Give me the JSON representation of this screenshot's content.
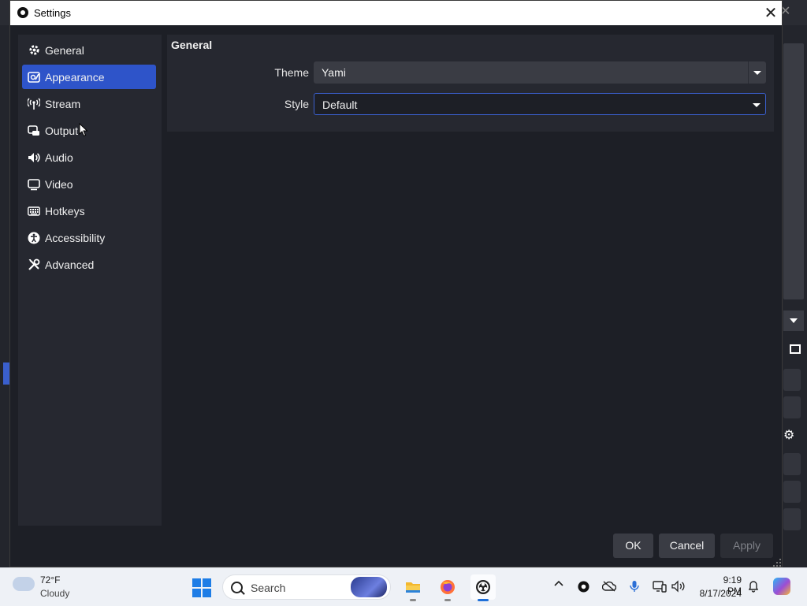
{
  "window": {
    "title": "Settings",
    "close_glyph": "✕"
  },
  "sidebar": {
    "items": [
      {
        "label": "General",
        "icon": "gear-icon",
        "active": false
      },
      {
        "label": "Appearance",
        "icon": "appearance-icon",
        "active": true
      },
      {
        "label": "Stream",
        "icon": "broadcast-icon",
        "active": false
      },
      {
        "label": "Output",
        "icon": "output-icon",
        "active": false
      },
      {
        "label": "Audio",
        "icon": "speaker-icon",
        "active": false
      },
      {
        "label": "Video",
        "icon": "monitor-icon",
        "active": false
      },
      {
        "label": "Hotkeys",
        "icon": "keyboard-icon",
        "active": false
      },
      {
        "label": "Accessibility",
        "icon": "accessibility-icon",
        "active": false
      },
      {
        "label": "Advanced",
        "icon": "tools-icon",
        "active": false
      }
    ]
  },
  "main": {
    "section_title": "General",
    "theme": {
      "label": "Theme",
      "value": "Yami"
    },
    "style": {
      "label": "Style",
      "value": "Default"
    }
  },
  "buttons": {
    "ok": "OK",
    "cancel": "Cancel",
    "apply": "Apply"
  },
  "taskbar": {
    "weather": {
      "temp": "72°F",
      "condition": "Cloudy"
    },
    "search_placeholder": "Search",
    "apps": [
      "file-explorer-icon",
      "firefox-icon",
      "obs-icon"
    ],
    "clock": {
      "time": "9:19 PM",
      "date": "8/17/2024"
    }
  },
  "colors": {
    "accent": "#2e54c9",
    "background": "#1d1f26",
    "panel": "#262830"
  }
}
